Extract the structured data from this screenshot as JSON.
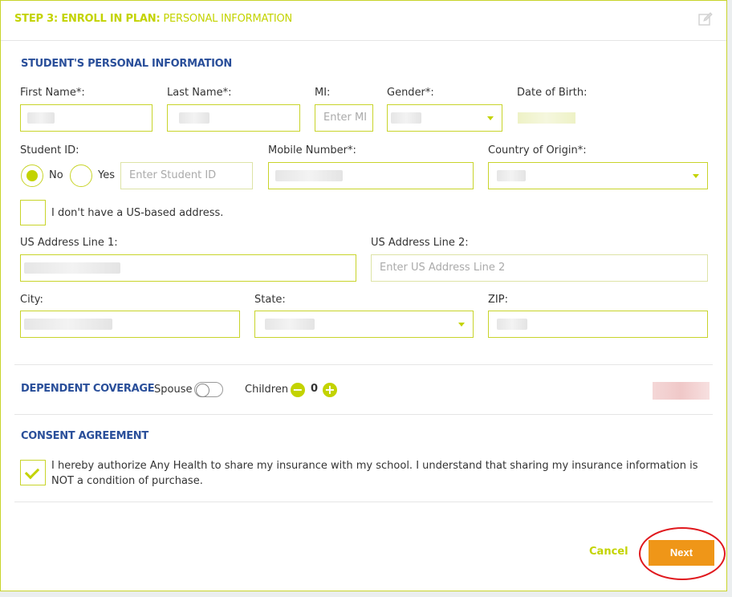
{
  "header": {
    "step_strong": "STEP 3: ENROLL IN PLAN:",
    "step_rest": " PERSONAL INFORMATION"
  },
  "personal": {
    "section_title": "STUDENT'S PERSONAL INFORMATION",
    "first_name_label": "First Name*:",
    "last_name_label": "Last Name*:",
    "mi_label": "MI:",
    "mi_placeholder": "Enter MI",
    "gender_label": "Gender*:",
    "dob_label": "Date of Birth:",
    "student_id_label": "Student ID:",
    "no_label": "No",
    "yes_label": "Yes",
    "student_id_placeholder": "Enter Student ID",
    "mobile_label": "Mobile Number*:",
    "country_label": "Country of Origin*:",
    "no_us_address_label": "I don't have a US-based address.",
    "address1_label": "US Address Line 1:",
    "address2_label": "US Address Line 2:",
    "address2_placeholder": "Enter US Address Line 2",
    "city_label": "City:",
    "state_label": "State:",
    "zip_label": "ZIP:"
  },
  "dependent": {
    "section_title": "DEPENDENT COVERAGE",
    "spouse_label": "Spouse",
    "children_label": "Children",
    "minus": "−",
    "children_count": "0",
    "plus": "+"
  },
  "consent": {
    "section_title": "CONSENT AGREEMENT",
    "text": "I hereby authorize Any Health to share my insurance with my school. I understand that sharing my insurance information is NOT a condition of purchase."
  },
  "actions": {
    "cancel_label": "Cancel",
    "next_label": "Next"
  },
  "colors": {
    "accent": "#c3d300",
    "heading": "#2a4f9a",
    "next_button": "#ef9618",
    "highlight": "#e0191e"
  }
}
